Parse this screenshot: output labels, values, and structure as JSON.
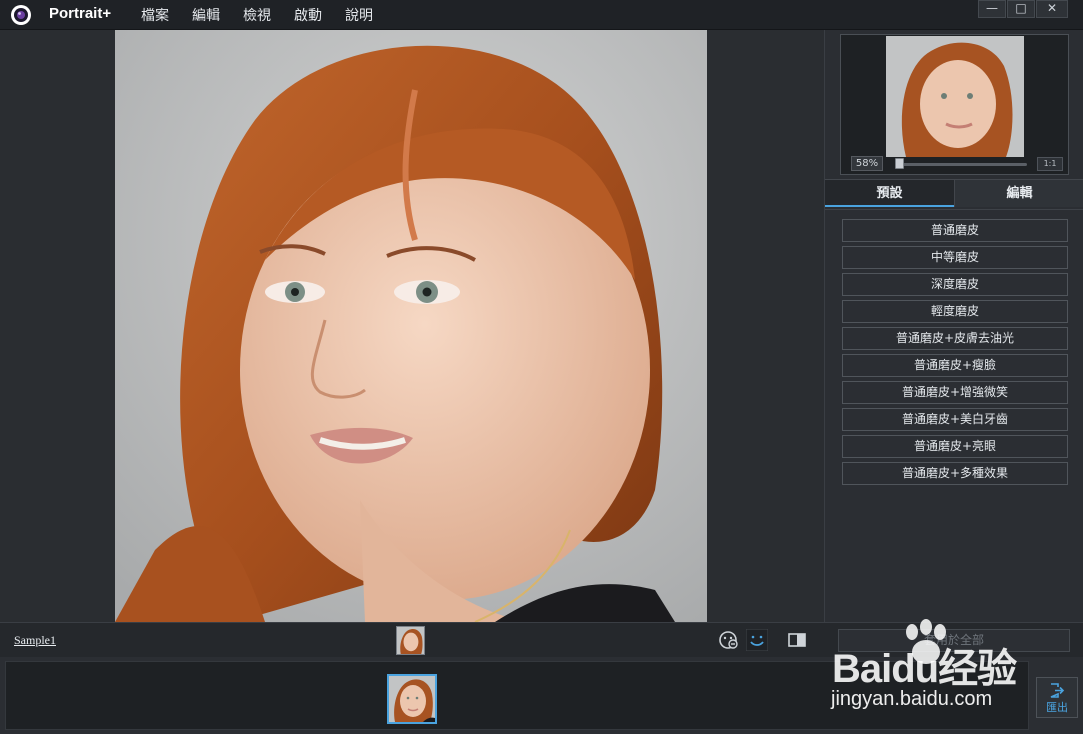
{
  "app": {
    "title": "Portrait+"
  },
  "menu": {
    "items": [
      "檔案",
      "編輯",
      "檢視",
      "啟動",
      "說明"
    ]
  },
  "window_controls": {
    "minimize": "—",
    "maximize": "□",
    "close": "✕"
  },
  "navigator": {
    "zoom": "58%",
    "fit_label": "1:1",
    "zoom_fraction": 0.0
  },
  "panel": {
    "tabs": [
      "預設",
      "編輯"
    ],
    "active_tab": "預設",
    "presets": [
      "普通磨皮",
      "中等磨皮",
      "深度磨皮",
      "輕度磨皮",
      "普通磨皮+皮膚去油光",
      "普通磨皮+瘦臉",
      "普通磨皮+增強微笑",
      "普通磨皮+美白牙齒",
      "普通磨皮+亮眼",
      "普通磨皮+多種效果"
    ]
  },
  "bottom": {
    "file_name": "Sample1",
    "apply_all": "套用於全部",
    "export_label": "匯出"
  },
  "icons": {
    "app_logo": "camera-lens-icon",
    "face_detect": "face-detect-icon",
    "smile": "smile-icon",
    "compare": "compare-view-icon",
    "export": "export-icon"
  },
  "watermark": {
    "brand": "Baidu经验",
    "url": "jingyan.baidu.com"
  },
  "colors": {
    "accent": "#4aa3df",
    "background": "#2b2e33",
    "titlebar": "#1f2226"
  }
}
